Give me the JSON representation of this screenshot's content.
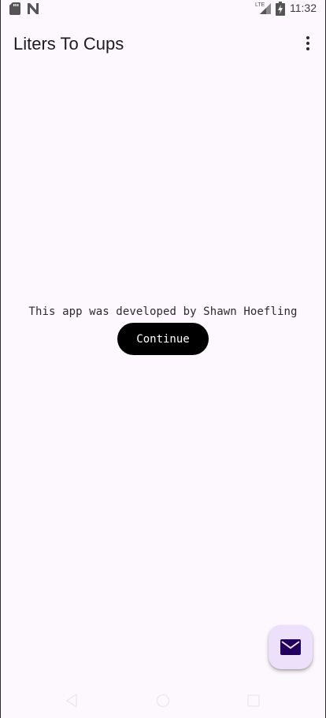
{
  "status_bar": {
    "time": "11:32",
    "network_label": "LTE",
    "icons": [
      "sd-card-icon",
      "n-logo-icon",
      "lte-signal-icon",
      "battery-icon"
    ]
  },
  "app_bar": {
    "title": "Liters To Cups",
    "overflow_icon": "more-vert-icon"
  },
  "main": {
    "credit_text": "This app was developed by Shawn Hoefling",
    "continue_label": "Continue"
  },
  "fab": {
    "icon": "email-icon"
  },
  "nav_bar": {
    "icons": [
      "back-icon",
      "home-icon",
      "recents-icon"
    ]
  },
  "colors": {
    "background": "#fdf7fe",
    "button_bg": "#000000",
    "button_text": "#ffffff",
    "fab_bg": "#ece0fa",
    "fab_icon": "#21005d"
  }
}
